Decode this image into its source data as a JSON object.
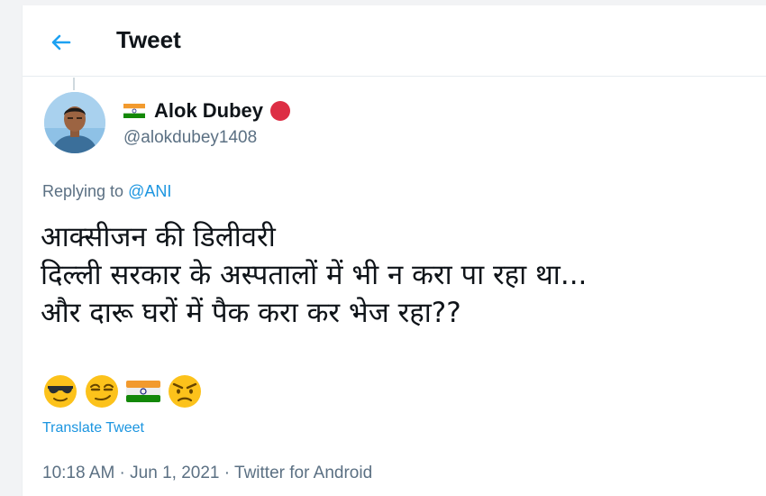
{
  "header": {
    "title": "Tweet",
    "back_icon": "arrow-left-icon",
    "accent": "#1da1f2"
  },
  "user": {
    "display_name": "Alok Dubey",
    "handle": "@alokdubey1408",
    "name_prefix_icon": "india-flag-icon",
    "name_suffix_icon": "red-circle-icon"
  },
  "tweet": {
    "replying_prefix": "Replying to",
    "replying_mention": "@ANI",
    "lines": [
      "आक्सीजन की डिलीवरी",
      "दिल्ली सरकार के अस्पतालों में भी न करा पा रहा था...",
      "और दारू घरों में पैक करा कर भेज रहा??"
    ],
    "emojis": [
      "sunglasses-face-icon",
      "smirking-face-icon",
      "india-flag-icon",
      "angry-face-icon"
    ],
    "translate_label": "Translate Tweet",
    "time": "10:18 AM",
    "separator": " · ",
    "date": "Jun 1, 2021",
    "source": "Twitter for Android",
    "link_color": "#1b95e0"
  }
}
